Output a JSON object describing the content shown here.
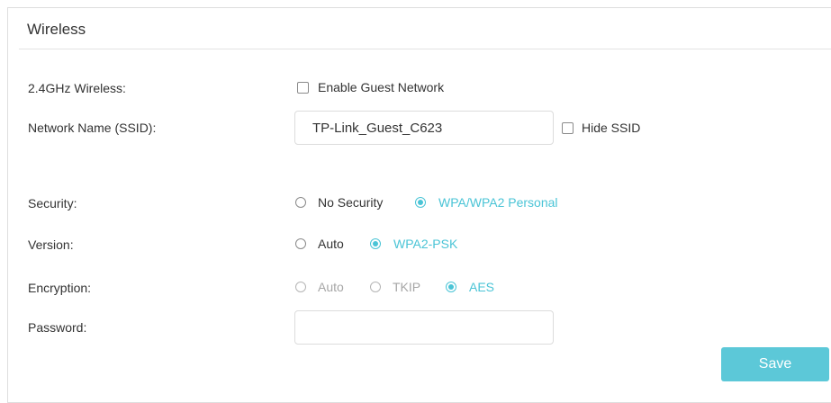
{
  "section": {
    "title": "Wireless"
  },
  "wireless_24": {
    "label": "2.4GHz Wireless:",
    "enable_guest_label": "Enable Guest Network"
  },
  "ssid": {
    "label": "Network Name (SSID):",
    "value": "TP-Link_Guest_C623",
    "hide_label": "Hide SSID"
  },
  "security": {
    "label": "Security:",
    "options": [
      "No Security",
      "WPA/WPA2 Personal"
    ],
    "selected": "WPA/WPA2 Personal"
  },
  "version": {
    "label": "Version:",
    "options": [
      "Auto",
      "WPA2-PSK"
    ],
    "selected": "WPA2-PSK"
  },
  "encryption": {
    "label": "Encryption:",
    "options": [
      "Auto",
      "TKIP",
      "AES"
    ],
    "selected": "AES"
  },
  "password": {
    "label": "Password:",
    "value": ""
  },
  "actions": {
    "save_label": "Save"
  },
  "colors": {
    "accent": "#4ac4d6",
    "save_button_bg": "#5cc8d8",
    "disabled_text": "#a6a6a6",
    "border": "#dedede"
  }
}
